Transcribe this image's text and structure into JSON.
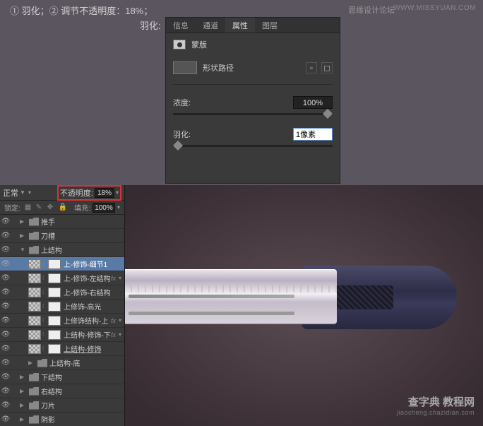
{
  "top": {
    "instruction": "① 羽化；② 调节不透明度：18%；",
    "label": "羽化:"
  },
  "watermarks": {
    "top1": "思缘设计论坛",
    "top2": "WWW.MISSYUAN.COM",
    "bottom1": "查字典 教程网",
    "bottom2": "jiaocheng.chazidian.com"
  },
  "panel": {
    "tabs": [
      "信息",
      "通道",
      "属性",
      "图层"
    ],
    "mask": "蒙版",
    "shape": "形状路径",
    "density_label": "浓度:",
    "density_value": "100%",
    "feather_label": "羽化:",
    "feather_value": "1像素"
  },
  "layers": {
    "mode": "正常",
    "opacity_label": "不透明度:",
    "opacity_value": "18%",
    "lock_label": "锁定:",
    "fill_label": "填充:",
    "fill_value": "100%",
    "fx": "fx",
    "items": [
      {
        "type": "folder",
        "name": "推手",
        "depth": 1
      },
      {
        "type": "folder",
        "name": "刀槽",
        "depth": 1
      },
      {
        "type": "folder",
        "name": "上结构",
        "depth": 1,
        "open": true
      },
      {
        "type": "layer",
        "name": "上-修饰-细节1",
        "depth": 2,
        "active": true
      },
      {
        "type": "layer",
        "name": "上-修饰-左结构",
        "depth": 2,
        "fx": true
      },
      {
        "type": "layer",
        "name": "上-修饰-右结构",
        "depth": 2
      },
      {
        "type": "layer",
        "name": "上修饰-高光",
        "depth": 2
      },
      {
        "type": "layer",
        "name": "上修饰结构-上",
        "depth": 2,
        "fx": true
      },
      {
        "type": "layer",
        "name": "上结构-修饰-下",
        "depth": 2,
        "fx": true
      },
      {
        "type": "layer",
        "name": "上结构-修饰",
        "depth": 2,
        "underline": true
      },
      {
        "type": "folder",
        "name": "上结构-底",
        "depth": 2
      },
      {
        "type": "folder",
        "name": "下结构",
        "depth": 1
      },
      {
        "type": "folder",
        "name": "右结构",
        "depth": 1
      },
      {
        "type": "folder",
        "name": "刀片",
        "depth": 1
      },
      {
        "type": "folder",
        "name": "阴影",
        "depth": 1
      }
    ]
  }
}
